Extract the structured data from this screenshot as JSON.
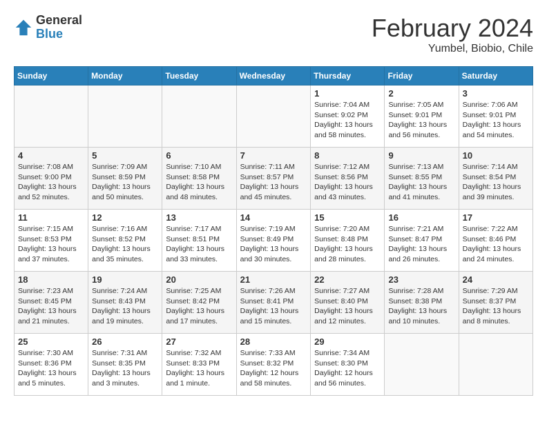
{
  "logo": {
    "general": "General",
    "blue": "Blue"
  },
  "title": {
    "month": "February 2024",
    "location": "Yumbel, Biobio, Chile"
  },
  "weekdays": [
    "Sunday",
    "Monday",
    "Tuesday",
    "Wednesday",
    "Thursday",
    "Friday",
    "Saturday"
  ],
  "weeks": [
    [
      {
        "day": "",
        "info": ""
      },
      {
        "day": "",
        "info": ""
      },
      {
        "day": "",
        "info": ""
      },
      {
        "day": "",
        "info": ""
      },
      {
        "day": "1",
        "info": "Sunrise: 7:04 AM\nSunset: 9:02 PM\nDaylight: 13 hours\nand 58 minutes."
      },
      {
        "day": "2",
        "info": "Sunrise: 7:05 AM\nSunset: 9:01 PM\nDaylight: 13 hours\nand 56 minutes."
      },
      {
        "day": "3",
        "info": "Sunrise: 7:06 AM\nSunset: 9:01 PM\nDaylight: 13 hours\nand 54 minutes."
      }
    ],
    [
      {
        "day": "4",
        "info": "Sunrise: 7:08 AM\nSunset: 9:00 PM\nDaylight: 13 hours\nand 52 minutes."
      },
      {
        "day": "5",
        "info": "Sunrise: 7:09 AM\nSunset: 8:59 PM\nDaylight: 13 hours\nand 50 minutes."
      },
      {
        "day": "6",
        "info": "Sunrise: 7:10 AM\nSunset: 8:58 PM\nDaylight: 13 hours\nand 48 minutes."
      },
      {
        "day": "7",
        "info": "Sunrise: 7:11 AM\nSunset: 8:57 PM\nDaylight: 13 hours\nand 45 minutes."
      },
      {
        "day": "8",
        "info": "Sunrise: 7:12 AM\nSunset: 8:56 PM\nDaylight: 13 hours\nand 43 minutes."
      },
      {
        "day": "9",
        "info": "Sunrise: 7:13 AM\nSunset: 8:55 PM\nDaylight: 13 hours\nand 41 minutes."
      },
      {
        "day": "10",
        "info": "Sunrise: 7:14 AM\nSunset: 8:54 PM\nDaylight: 13 hours\nand 39 minutes."
      }
    ],
    [
      {
        "day": "11",
        "info": "Sunrise: 7:15 AM\nSunset: 8:53 PM\nDaylight: 13 hours\nand 37 minutes."
      },
      {
        "day": "12",
        "info": "Sunrise: 7:16 AM\nSunset: 8:52 PM\nDaylight: 13 hours\nand 35 minutes."
      },
      {
        "day": "13",
        "info": "Sunrise: 7:17 AM\nSunset: 8:51 PM\nDaylight: 13 hours\nand 33 minutes."
      },
      {
        "day": "14",
        "info": "Sunrise: 7:19 AM\nSunset: 8:49 PM\nDaylight: 13 hours\nand 30 minutes."
      },
      {
        "day": "15",
        "info": "Sunrise: 7:20 AM\nSunset: 8:48 PM\nDaylight: 13 hours\nand 28 minutes."
      },
      {
        "day": "16",
        "info": "Sunrise: 7:21 AM\nSunset: 8:47 PM\nDaylight: 13 hours\nand 26 minutes."
      },
      {
        "day": "17",
        "info": "Sunrise: 7:22 AM\nSunset: 8:46 PM\nDaylight: 13 hours\nand 24 minutes."
      }
    ],
    [
      {
        "day": "18",
        "info": "Sunrise: 7:23 AM\nSunset: 8:45 PM\nDaylight: 13 hours\nand 21 minutes."
      },
      {
        "day": "19",
        "info": "Sunrise: 7:24 AM\nSunset: 8:43 PM\nDaylight: 13 hours\nand 19 minutes."
      },
      {
        "day": "20",
        "info": "Sunrise: 7:25 AM\nSunset: 8:42 PM\nDaylight: 13 hours\nand 17 minutes."
      },
      {
        "day": "21",
        "info": "Sunrise: 7:26 AM\nSunset: 8:41 PM\nDaylight: 13 hours\nand 15 minutes."
      },
      {
        "day": "22",
        "info": "Sunrise: 7:27 AM\nSunset: 8:40 PM\nDaylight: 13 hours\nand 12 minutes."
      },
      {
        "day": "23",
        "info": "Sunrise: 7:28 AM\nSunset: 8:38 PM\nDaylight: 13 hours\nand 10 minutes."
      },
      {
        "day": "24",
        "info": "Sunrise: 7:29 AM\nSunset: 8:37 PM\nDaylight: 13 hours\nand 8 minutes."
      }
    ],
    [
      {
        "day": "25",
        "info": "Sunrise: 7:30 AM\nSunset: 8:36 PM\nDaylight: 13 hours\nand 5 minutes."
      },
      {
        "day": "26",
        "info": "Sunrise: 7:31 AM\nSunset: 8:35 PM\nDaylight: 13 hours\nand 3 minutes."
      },
      {
        "day": "27",
        "info": "Sunrise: 7:32 AM\nSunset: 8:33 PM\nDaylight: 13 hours\nand 1 minute."
      },
      {
        "day": "28",
        "info": "Sunrise: 7:33 AM\nSunset: 8:32 PM\nDaylight: 12 hours\nand 58 minutes."
      },
      {
        "day": "29",
        "info": "Sunrise: 7:34 AM\nSunset: 8:30 PM\nDaylight: 12 hours\nand 56 minutes."
      },
      {
        "day": "",
        "info": ""
      },
      {
        "day": "",
        "info": ""
      }
    ]
  ]
}
